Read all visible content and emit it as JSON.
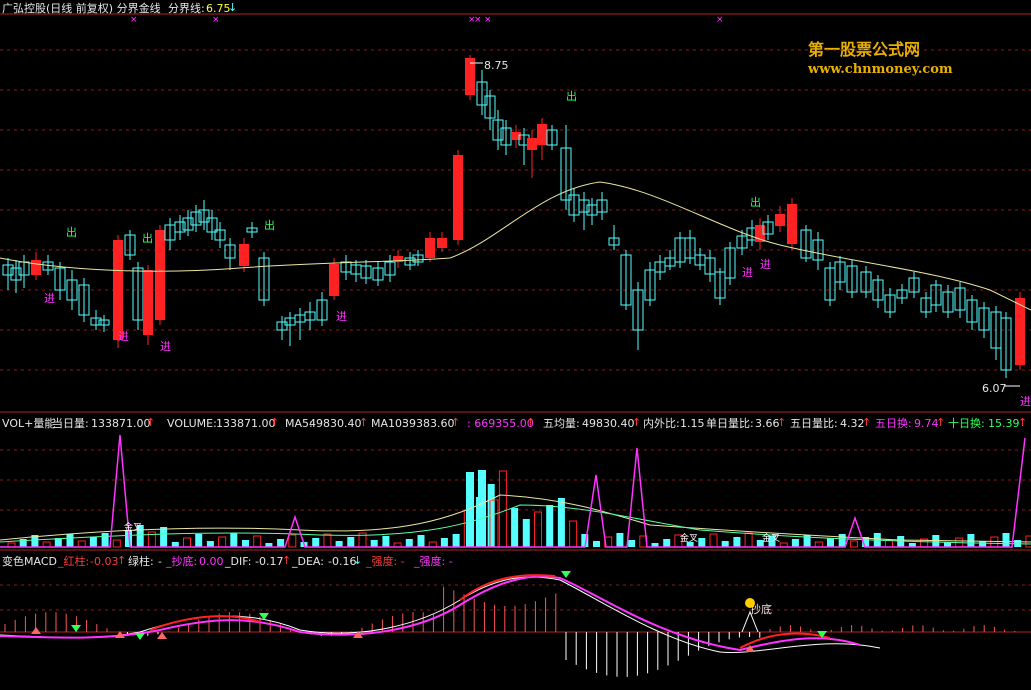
{
  "title_bar": {
    "title": "广弘控股(日线 前复权) 分界金线",
    "boundary_label": "分界线:",
    "boundary_value": "6.75"
  },
  "watermark": {
    "name": "第一股票公式网",
    "url": "www.chnmoney.com"
  },
  "price_panel": {
    "high_label": "8.75",
    "low_label": "6.07",
    "signal_buy": "进",
    "signal_sell": "出"
  },
  "volume_panel": {
    "title": "VOL+量能",
    "today_vol_label": "当日量:",
    "today_vol": "133871.00",
    "volume_label": "VOLUME:",
    "volume": "133871.00",
    "ma5_label": "MA5:",
    "ma5": "49830.40",
    "ma10_label": "MA10:",
    "ma10": "39383.60",
    "extra": ": 669355.00",
    "five_avg_label": "五均量:",
    "five_avg": "49830.40",
    "in_out_label": "内外比:",
    "in_out": "1.15",
    "single_ratio_label": "单日量比:",
    "single_ratio": "3.66",
    "five_ratio_label": "五日量比:",
    "five_ratio": "4.32",
    "five_turn_label": "五日换:",
    "five_turn": "9.74",
    "ten_turn_label": "十日换:",
    "ten_turn": "15.39",
    "golden_cross": "金叉"
  },
  "macd_panel": {
    "title": "变色MACD",
    "red_label": "_红柱:",
    "red": "-0.03",
    "green_label": "绿柱:",
    "green": "-",
    "bottom_label": "_抄底:",
    "bottom": "0.00",
    "dif_label": "_DIF:",
    "dif": "-0.17",
    "dea_label": "_DEA:",
    "dea": "-0.16",
    "strength1": "_强度: -",
    "strength2": "_强度: -",
    "bottom_mark": "抄底"
  },
  "colors": {
    "up": "#ff2222",
    "down": "#55ffff",
    "ma": "#e8e6a0",
    "grid": "#8b1a1a",
    "volline": "#ff33ff"
  }
}
